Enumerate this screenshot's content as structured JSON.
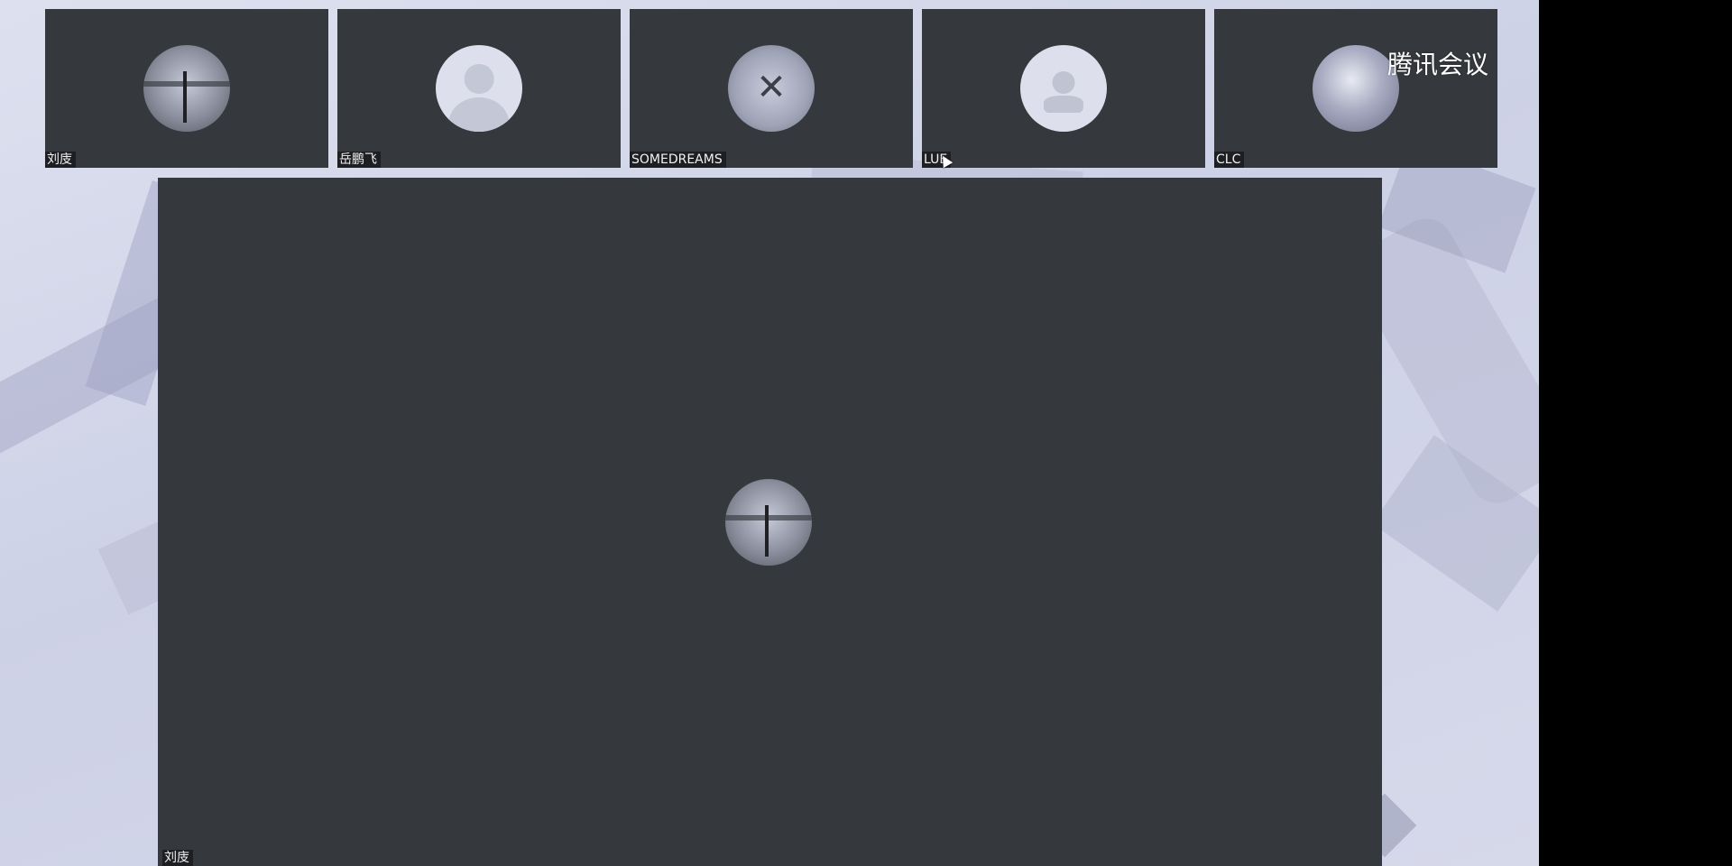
{
  "app": {
    "brand_label": "腾讯会议"
  },
  "participants": [
    {
      "name": "刘庋",
      "avatar": "photo-avatar"
    },
    {
      "name": "岳鹏飞",
      "avatar": "default-avatar"
    },
    {
      "name": "SOMEDREAMS",
      "avatar": "cartoon-avatar"
    },
    {
      "name": "LUE",
      "avatar": "user-icon-avatar"
    },
    {
      "name": "CLC",
      "avatar": "pet-photo-avatar"
    }
  ],
  "main_view": {
    "speaker_name": "刘庋",
    "avatar": "photo-avatar"
  },
  "colors": {
    "tile_bg": "#35383c",
    "label_bg": "#1d1f22",
    "label_text": "#f2f2f2",
    "background": "#d3d6e8"
  }
}
